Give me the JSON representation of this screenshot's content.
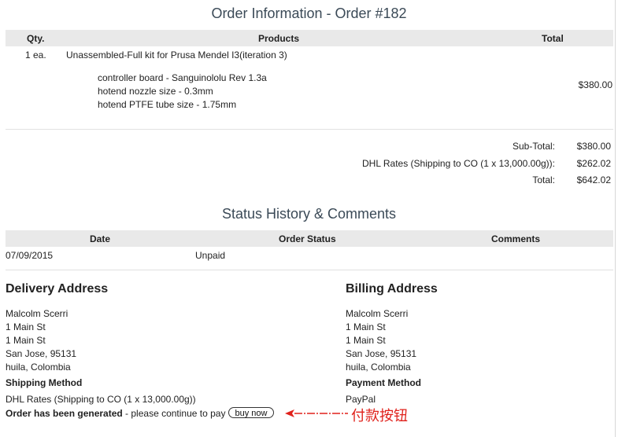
{
  "order_title": "Order Information - Order #182",
  "products_table": {
    "headers": {
      "qty": "Qty.",
      "products": "Products",
      "total": "Total"
    },
    "row": {
      "qty": "1 ea.",
      "name": "Unassembled-Full kit for Prusa Mendel I3(iteration 3)",
      "options": [
        "controller board - Sanguinololu Rev 1.3a",
        "hotend nozzle size - 0.3mm",
        "hotend PTFE tube size - 1.75mm"
      ],
      "price": "$380.00"
    }
  },
  "totals": [
    {
      "label": "Sub-Total:",
      "value": "$380.00"
    },
    {
      "label": "DHL Rates (Shipping to CO (1 x 13,000.00g)):",
      "value": "$262.02"
    },
    {
      "label": "Total:",
      "value": "$642.02"
    }
  ],
  "status_title": "Status History & Comments",
  "status_table": {
    "headers": {
      "date": "Date",
      "status": "Order Status",
      "comments": "Comments"
    },
    "row": {
      "date": "07/09/2015",
      "status": "Unpaid",
      "comments": ""
    }
  },
  "delivery": {
    "title": "Delivery Address",
    "lines": [
      "Malcolm Scerri",
      "1 Main St",
      "1 Main St",
      "San Jose, 95131",
      "huila, Colombia"
    ],
    "method_title": "Shipping Method",
    "method": "DHL Rates (Shipping to CO (1 x 13,000.00g))"
  },
  "billing": {
    "title": "Billing Address",
    "lines": [
      "Malcolm Scerri",
      "1 Main St",
      "1 Main St",
      "San Jose, 95131",
      "huila, Colombia"
    ],
    "method_title": "Payment Method",
    "method": "PayPal"
  },
  "order_note": {
    "bold": "Order has been generated",
    "rest": " - please continue to pay",
    "button": "buy now"
  },
  "annotation": {
    "text": "付款按钮",
    "color": "#e0211b"
  }
}
